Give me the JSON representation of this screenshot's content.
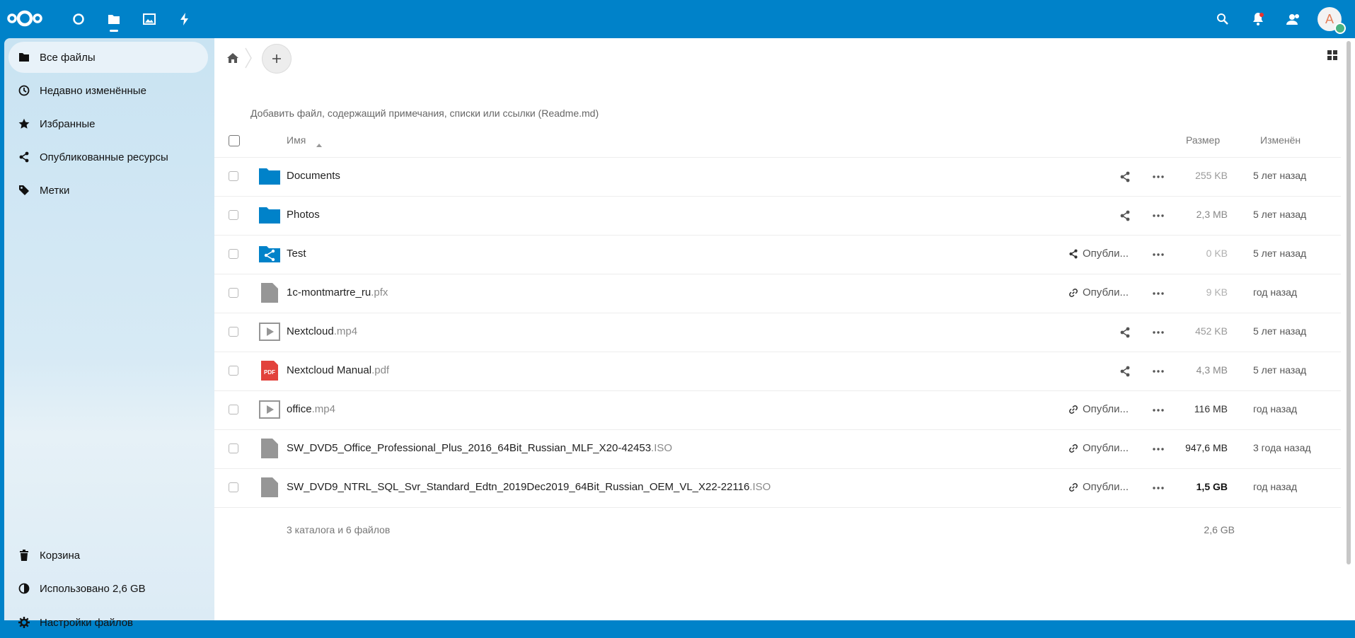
{
  "header": {
    "apps": [
      {
        "name": "dashboard",
        "icon": "circle-icon"
      },
      {
        "name": "files",
        "icon": "folder-icon"
      },
      {
        "name": "photos",
        "icon": "image-icon"
      },
      {
        "name": "activity",
        "icon": "lightning-icon"
      }
    ],
    "avatar_letter": "A",
    "accent": "#0082c9"
  },
  "sidebar": {
    "items": [
      {
        "label": "Все файлы",
        "icon": "folder-icon"
      },
      {
        "label": "Недавно изменённые",
        "icon": "clock-icon"
      },
      {
        "label": "Избранные",
        "icon": "star-icon"
      },
      {
        "label": "Опубликованные ресурсы",
        "icon": "share-icon"
      },
      {
        "label": "Метки",
        "icon": "tag-icon"
      }
    ],
    "bottom": {
      "trash": "Корзина",
      "quota": "Использовано 2,6 GB",
      "settings": "Настройки файлов"
    }
  },
  "main": {
    "readme_hint": "Добавить файл, содержащий примечания, списки или ссылки (Readme.md)",
    "columns": {
      "name": "Имя",
      "size": "Размер",
      "modified": "Изменён"
    },
    "files": [
      {
        "base": "Documents",
        "ext": "",
        "type": "folder",
        "shared_label": "",
        "size": "255 KB",
        "modified": "5 лет назад"
      },
      {
        "base": "Photos",
        "ext": "",
        "type": "folder",
        "shared_label": "",
        "size": "2,3 MB",
        "modified": "5 лет назад"
      },
      {
        "base": "Test",
        "ext": "",
        "type": "shared-folder",
        "shared_label": "Опубли...",
        "size": "0 KB",
        "modified": "5 лет назад"
      },
      {
        "base": "1c-montmartre_ru",
        "ext": ".pfx",
        "type": "file",
        "shared_label": "Опубли...",
        "size": "9 KB",
        "modified": "год назад"
      },
      {
        "base": "Nextcloud",
        "ext": ".mp4",
        "type": "video",
        "shared_label": "",
        "size": "452 KB",
        "modified": "5 лет назад"
      },
      {
        "base": "Nextcloud Manual",
        "ext": ".pdf",
        "type": "pdf",
        "shared_label": "",
        "size": "4,3 MB",
        "modified": "5 лет назад"
      },
      {
        "base": "office",
        "ext": ".mp4",
        "type": "video",
        "shared_label": "Опубли...",
        "size": "116 MB",
        "modified": "год назад"
      },
      {
        "base": "SW_DVD5_Office_Professional_Plus_2016_64Bit_Russian_MLF_X20-42453",
        "ext": ".ISO",
        "type": "file",
        "shared_label": "Опубли...",
        "size": "947,6 MB",
        "modified": "3 года назад"
      },
      {
        "base": "SW_DVD9_NTRL_SQL_Svr_Standard_Edtn_2019Dec2019_64Bit_Russian_OEM_VL_X22-22116",
        "ext": ".ISO",
        "type": "file",
        "shared_label": "Опубли...",
        "size": "1,5 GB",
        "modified": "год назад"
      }
    ],
    "summary": "3 каталога и 6 файлов",
    "summary_size": "2,6 GB",
    "pdf_badge": "PDF"
  }
}
